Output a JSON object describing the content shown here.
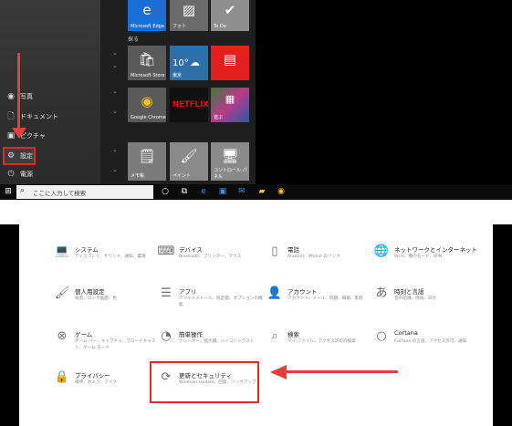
{
  "start_menu": {
    "rail": {
      "items": [
        {
          "label": "写真",
          "icon": "photos-icon"
        },
        {
          "label": "ドキュメント",
          "icon": "document-icon"
        },
        {
          "label": "ピクチャ",
          "icon": "pictures-icon"
        },
        {
          "label": "設定",
          "icon": "gear-icon"
        },
        {
          "label": "電源",
          "icon": "power-icon"
        }
      ]
    },
    "group_label": "探る",
    "tiles": [
      {
        "label": "Microsoft Edge",
        "icon": "edge-icon",
        "color": "#1a6fd6"
      },
      {
        "label": "フォト",
        "icon": "photos-tile-icon",
        "color": "#6b6b6b"
      },
      {
        "label": "To Do",
        "icon": "checkmark-icon",
        "color": "#8e8e8e"
      },
      {
        "label": "Microsoft Store",
        "icon": "store-icon",
        "color": "#5a5a5a"
      },
      {
        "label": "10°",
        "sublabel": "東京",
        "icon": "weather-icon",
        "color": "#2f6fa8"
      },
      {
        "label": "",
        "icon": "news-icon",
        "color": "#e22020"
      },
      {
        "label": "Google Chrome",
        "icon": "chrome-icon",
        "color": "#5a5a5a"
      },
      {
        "label": "NETFLIX",
        "icon": "netflix-icon",
        "color": "#111111"
      },
      {
        "label": "遊ぶ",
        "icon": "games-icon",
        "color": "#3a7a3a"
      },
      {
        "label": "メモ帳",
        "icon": "notepad-icon",
        "color": "#7b7b7b"
      },
      {
        "label": "ペイント",
        "icon": "paint-icon",
        "color": "#8a8a8a"
      },
      {
        "label": "コントロール パネル",
        "icon": "control-panel-icon",
        "color": "#8a8a8a"
      }
    ],
    "taskbar": {
      "search_placeholder": "ここに入力して検索",
      "icons": [
        "windows-start-icon",
        "cortana-icon",
        "task-view-icon",
        "edge-icon",
        "store-icon",
        "mail-icon",
        "explorer-icon",
        "chrome-icon"
      ]
    }
  },
  "settings": {
    "items": [
      {
        "title": "システム",
        "desc": "ディスプレイ、サウンド、通知、電源",
        "icon": "laptop-icon"
      },
      {
        "title": "デバイス",
        "desc": "Bluetooth、プリンター、マウス",
        "icon": "keyboard-icon"
      },
      {
        "title": "電話",
        "desc": "Android、iPhone のリンク",
        "icon": "phone-icon"
      },
      {
        "title": "ネットワークとインターネット",
        "desc": "Wi-Fi、機内モード、VPN",
        "icon": "globe-icon"
      },
      {
        "title": "個人用設定",
        "desc": "背景、ロック画面、色",
        "icon": "brush-icon"
      },
      {
        "title": "アプリ",
        "desc": "アンインストール、既定値、オプションの機能",
        "icon": "apps-list-icon"
      },
      {
        "title": "アカウント",
        "desc": "アカウント、メール、同期、職場、家族",
        "icon": "person-icon"
      },
      {
        "title": "時刻と言語",
        "desc": "音声認識、地域、日付",
        "icon": "time-language-icon"
      },
      {
        "title": "ゲーム",
        "desc": "ゲーム バー、キャプチャ、ブロードキャスト、ゲーム モード",
        "icon": "xbox-icon"
      },
      {
        "title": "簡単操作",
        "desc": "ナレーター、拡大鏡、ハイコントラスト",
        "icon": "ease-of-access-icon"
      },
      {
        "title": "検索",
        "desc": "マイ ファイル、アクセス許可の検索",
        "icon": "search-icon"
      },
      {
        "title": "Cortana",
        "desc": "Cortana の言語、アクセス許可、通知",
        "icon": "cortana-ring-icon"
      },
      {
        "title": "プライバシー",
        "desc": "場所、カメラ、マイク",
        "icon": "lock-icon"
      },
      {
        "title": "更新とセキュリティ",
        "desc": "Windows Update、回復、バックアップ",
        "icon": "sync-icon"
      }
    ]
  },
  "colors": {
    "highlight": "#e02a2a",
    "arrow": "#e34040"
  }
}
